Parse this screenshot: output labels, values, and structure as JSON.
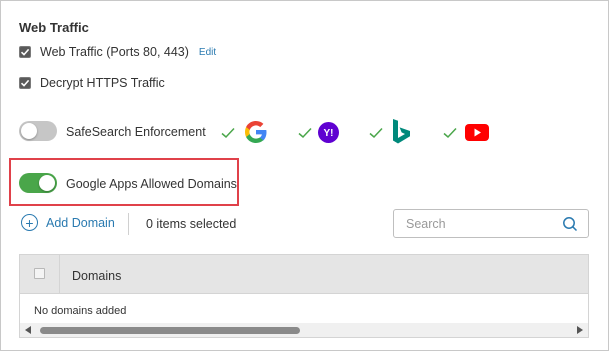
{
  "section_title": "Web Traffic",
  "web_traffic": {
    "label": "Web Traffic (Ports 80, 443)",
    "checked": true,
    "edit_label": "Edit"
  },
  "decrypt_https": {
    "label": "Decrypt HTTPS Traffic",
    "checked": true
  },
  "safesearch": {
    "label": "SafeSearch Enforcement",
    "enabled": false,
    "engines": [
      {
        "icon": "google-icon",
        "checked": true
      },
      {
        "icon": "yahoo-icon",
        "checked": true
      },
      {
        "icon": "bing-icon",
        "checked": true
      },
      {
        "icon": "youtube-icon",
        "checked": true
      }
    ]
  },
  "google_apps": {
    "label": "Google Apps Allowed Domains",
    "enabled": true
  },
  "toolbar": {
    "add_domain_label": "Add Domain",
    "items_selected": "0 items selected",
    "search_placeholder": "Search"
  },
  "table": {
    "columns": [
      "Domains"
    ],
    "empty_message": "No domains added"
  },
  "colors": {
    "toggle_on": "#4aa64a",
    "toggle_off": "#c6c6c6",
    "link": "#2a7ab0",
    "highlight": "#e0414a",
    "check": "#4aa64a"
  }
}
